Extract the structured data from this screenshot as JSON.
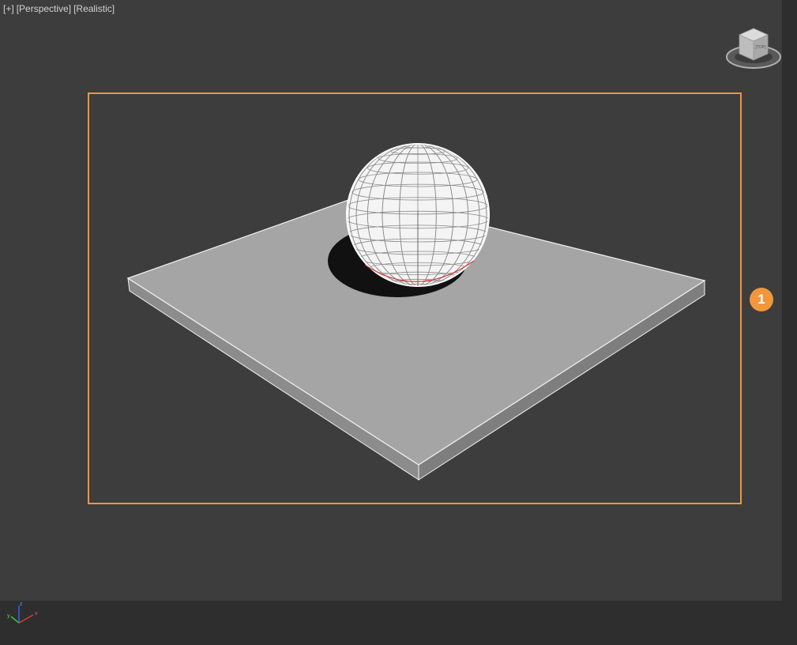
{
  "viewport": {
    "label_plus": "[+]",
    "label_view": "[Perspective]",
    "label_shading": "[Realistic]"
  },
  "callout": {
    "number": "1"
  },
  "viewcube": {
    "face_label": "[TOP]"
  },
  "axis_tripod": {
    "x": "x",
    "y": "y",
    "z": "z"
  },
  "colors": {
    "viewport_bg": "#3d3d3d",
    "safe_frame": "#f2963c",
    "callout_bg": "#f2963c",
    "plane_top": "#a5a5a5",
    "wireframe": "#ffffff"
  },
  "scene_objects": [
    "plane",
    "sphere"
  ]
}
